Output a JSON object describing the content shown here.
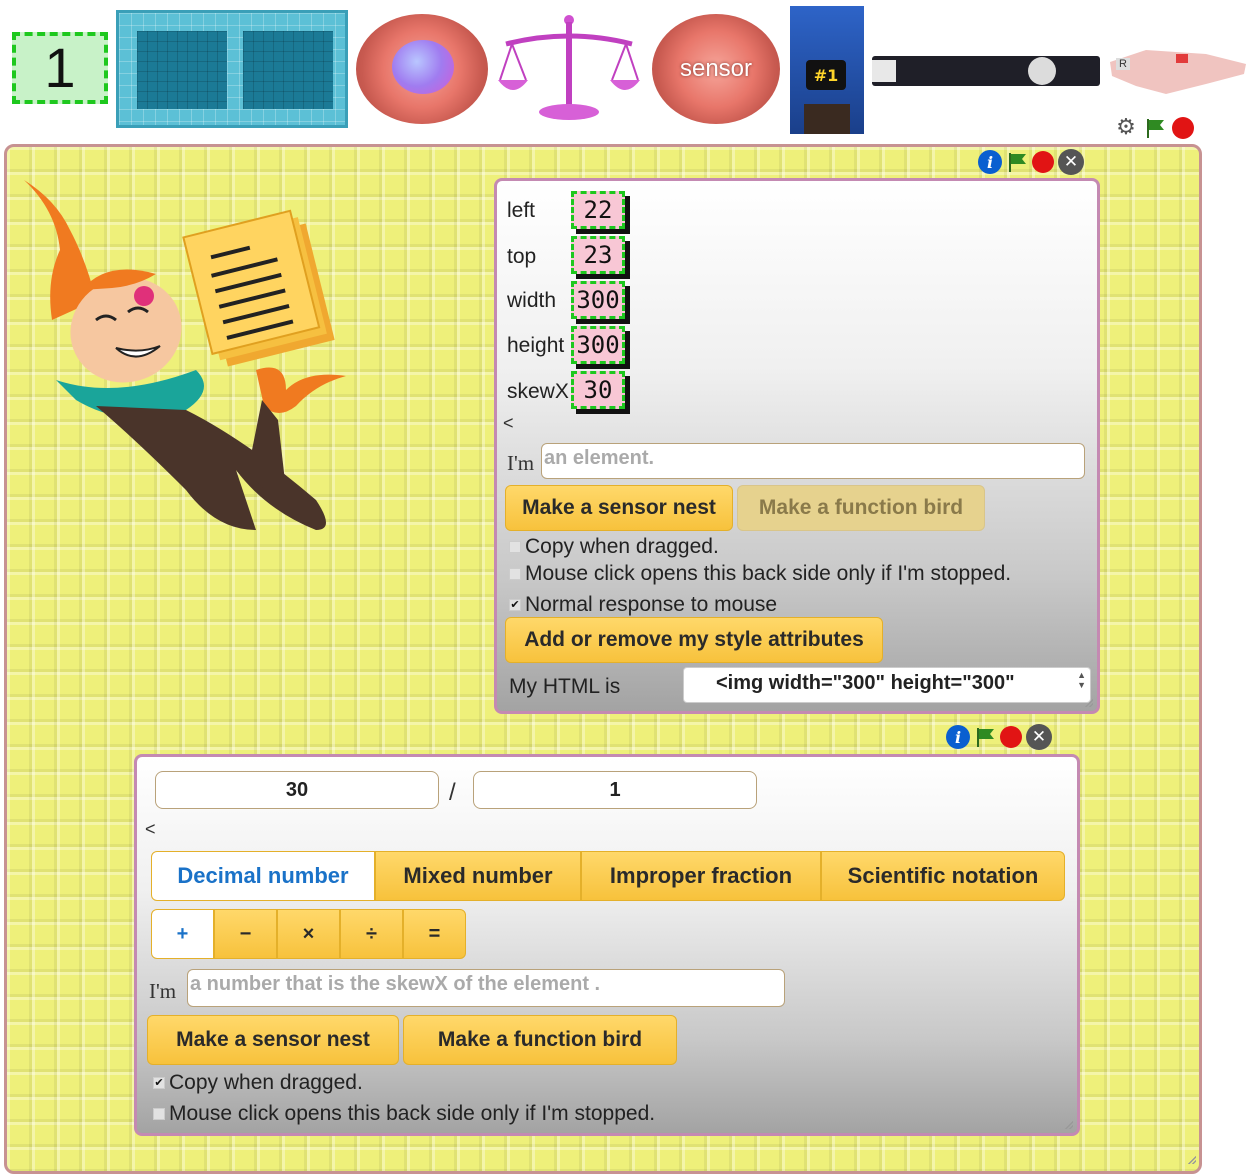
{
  "toolbar": {
    "count": "1",
    "sensor_label": "sensor",
    "robot_badge": "#1",
    "bird_letter": "R",
    "icons": [
      "box-icon",
      "nest-icon",
      "scale-icon",
      "sensor-icon",
      "robot-icon",
      "bar-icon",
      "bird-icon",
      "gear-icon",
      "flag-icon",
      "stop-icon"
    ]
  },
  "element_backside": {
    "properties": [
      {
        "label": "left",
        "value": "22"
      },
      {
        "label": "top",
        "value": "23"
      },
      {
        "label": "width",
        "value": "300"
      },
      {
        "label": "height",
        "value": "300"
      },
      {
        "label": "skewX",
        "value": "30"
      }
    ],
    "collapse": "<",
    "im_label": "I'm",
    "description": "an element.",
    "buttons": {
      "sensor_nest": "Make a sensor nest",
      "function_bird": "Make a function bird",
      "style_attributes": "Add or remove my style attributes"
    },
    "checks": [
      {
        "label": "Copy when dragged.",
        "checked": false,
        "mark": ""
      },
      {
        "label": "Mouse click opens this back side only if I'm stopped.",
        "checked": false,
        "mark": ""
      },
      {
        "label": "Normal response to mouse",
        "checked": true,
        "mark": "✔"
      }
    ],
    "html_label": "My HTML is",
    "html_value": "<img width=\"300\" height=\"300\""
  },
  "number_backside": {
    "numerator": "30",
    "slash": "/",
    "denominator": "1",
    "collapse": "<",
    "tabs": [
      "Decimal number",
      "Mixed number",
      "Improper fraction",
      "Scientific notation"
    ],
    "active_tab": "Decimal number",
    "operators": [
      "+",
      "−",
      "×",
      "÷",
      "="
    ],
    "active_operator": "+",
    "im_label": "I'm",
    "description": "a number that is the skewX of the element .",
    "buttons": {
      "sensor_nest": "Make a sensor nest",
      "function_bird": "Make a function bird"
    },
    "checks": [
      {
        "label": "Copy when dragged.",
        "checked": true,
        "mark": "✔"
      },
      {
        "label": "Mouse click opens this back side only if I'm stopped.",
        "checked": false,
        "mark": ""
      }
    ]
  },
  "colors": {
    "accent_button": "#f7c23c",
    "active_tab_text": "#1a72c8",
    "number_cell_bg": "#f8c7d5",
    "dashed_border": "#1ec81e",
    "workspace_bg": "#eef07a"
  }
}
